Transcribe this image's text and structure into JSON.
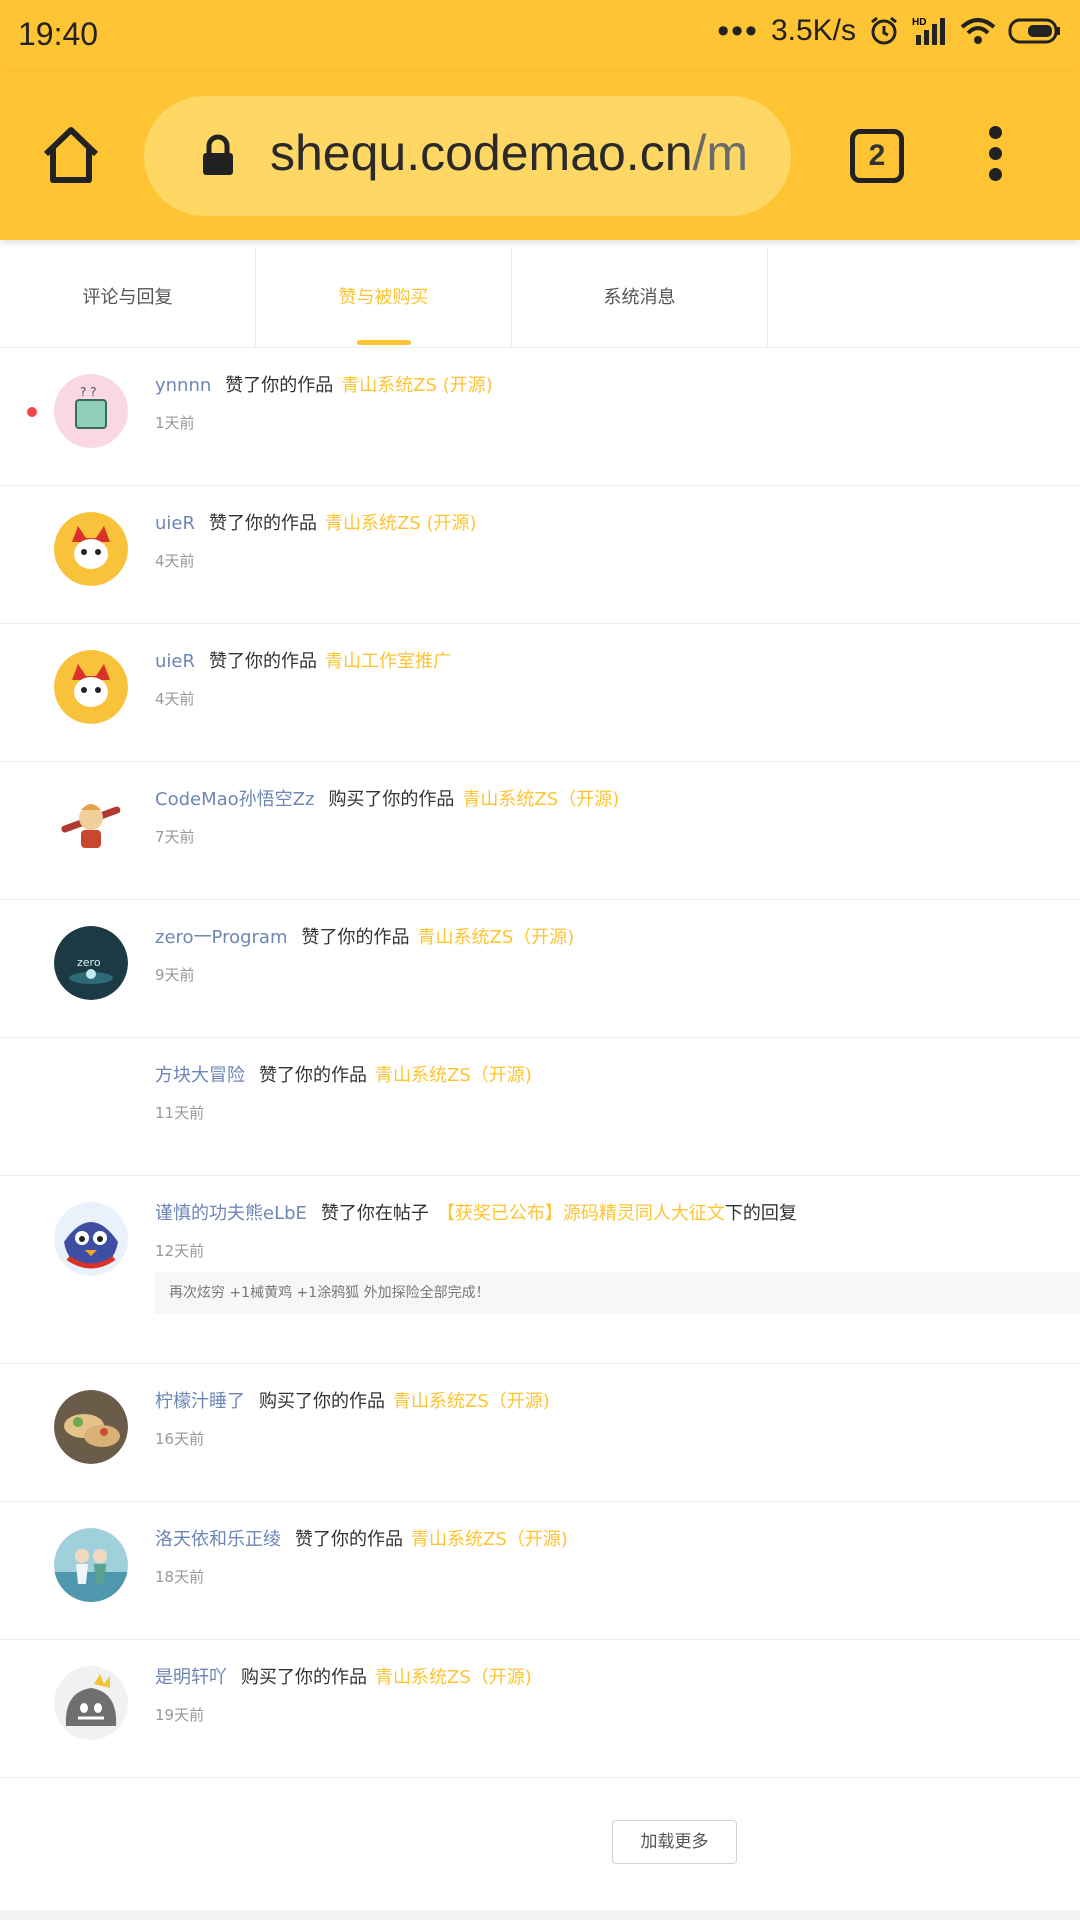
{
  "status": {
    "time": "19:40",
    "speed": "3.5K/s",
    "net_badge": "HD"
  },
  "browser": {
    "url_main": "shequ.codemao.cn",
    "url_rest": "/m",
    "tab_count": "2"
  },
  "tabs": [
    {
      "label": "评论与回复"
    },
    {
      "label": "赞与被购买"
    },
    {
      "label": "系统消息"
    }
  ],
  "items": [
    {
      "user": "ynnnn",
      "action": "赞了你的作品",
      "work": "青山系统ZS (开源)",
      "after": "",
      "time": "1天前",
      "unread": true,
      "avatar_color": "#f9d7e4"
    },
    {
      "user": "uieR",
      "action": "赞了你的作品",
      "work": "青山系统ZS (开源)",
      "after": "",
      "time": "4天前",
      "avatar_color": "#f8c23a"
    },
    {
      "user": "uieR",
      "action": "赞了你的作品",
      "work": "青山工作室推广",
      "after": "",
      "time": "4天前",
      "avatar_color": "#f8c23a"
    },
    {
      "user": "CodeMao孙悟空Zz",
      "action": "购买了你的作品",
      "work": "青山系统ZS（开源)",
      "after": "",
      "time": "7天前",
      "avatar_color": "#ffffff"
    },
    {
      "user": "zero一Program",
      "action": "赞了你的作品",
      "work": "青山系统ZS（开源)",
      "after": "",
      "time": "9天前",
      "avatar_color": "#1b3a44"
    },
    {
      "user": "方块大冒险",
      "action": "赞了你的作品",
      "work": "青山系统ZS（开源)",
      "after": "",
      "time": "11天前",
      "avatar_color": "#ffffff"
    },
    {
      "user": "谨慎的功夫熊eLbE",
      "action": "赞了你在帖子",
      "work": "【获奖已公布】源码精灵同人大征文",
      "after": "下的回复",
      "time": "12天前",
      "quote": "再次炫穷 +1械黄鸡 +1涂鸦狐 外加探险全部完成！",
      "avatar_color": "#3e4fa3"
    },
    {
      "user": "柠檬汁睡了",
      "action": "购买了你的作品",
      "work": "青山系统ZS（开源)",
      "after": "",
      "time": "16天前",
      "avatar_color": "#7a6a55"
    },
    {
      "user": "洛天依和乐正绫",
      "action": "赞了你的作品",
      "work": "青山系统ZS（开源)",
      "after": "",
      "time": "18天前",
      "avatar_color": "#7fb6c4"
    },
    {
      "user": "是明轩吖",
      "action": "购买了你的作品",
      "work": "青山系统ZS（开源)",
      "after": "",
      "time": "19天前",
      "avatar_color": "#6f6f6f"
    }
  ],
  "load_more": "加载更多",
  "colors": {
    "accent": "#fec433",
    "username": "#6d86b6",
    "unread": "#f04848"
  }
}
